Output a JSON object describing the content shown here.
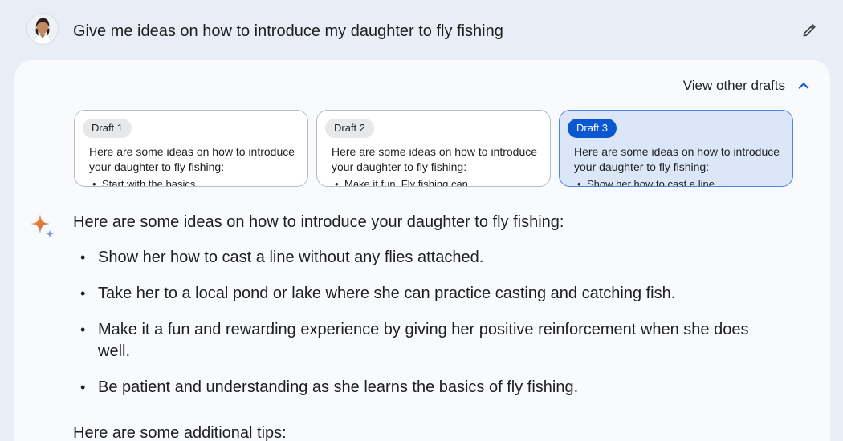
{
  "prompt": {
    "text": "Give me ideas on how to introduce my daughter to fly fishing",
    "avatar_icon": "user-avatar",
    "edit_icon": "pencil-icon"
  },
  "drafts_header": {
    "label": "View other drafts",
    "icon": "chevron-up-icon",
    "accent_color": "#0b57d0"
  },
  "drafts": [
    {
      "label": "Draft 1",
      "snippet": "Here are some ideas on how to introduce your daughter to fly fishing:",
      "bullet": "Start with the basics",
      "active": false
    },
    {
      "label": "Draft 2",
      "snippet": "Here are some ideas on how to introduce your daughter to fly fishing:",
      "bullet": "Make it fun. Fly fishing can",
      "active": false
    },
    {
      "label": "Draft 3",
      "snippet": "Here are some ideas on how to introduce your daughter to fly fishing:",
      "bullet": "Show her how to cast a line",
      "active": true
    }
  ],
  "answer": {
    "icon": "sparkle-icon",
    "intro": "Here are some ideas on how to introduce your daughter to fly fishing:",
    "items": [
      "Show her how to cast a line without any flies attached.",
      "Take her to a local pond or lake where she can practice casting and catching fish.",
      "Make it a fun and rewarding experience by giving her positive reinforcement when she does well.",
      "Be patient and understanding as she learns the basics of fly fishing."
    ],
    "tips_heading": "Here are some additional tips:"
  }
}
